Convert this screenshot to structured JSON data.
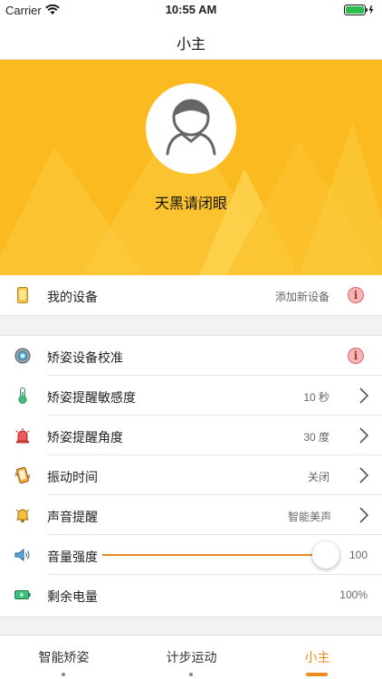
{
  "status_bar": {
    "carrier": "Carrier",
    "time": "10:55 AM"
  },
  "nav": {
    "title": "小主"
  },
  "header": {
    "username": "天黑请闭眼",
    "avatar_icon": "user-avatar-icon",
    "bg_color": "#fbbb20"
  },
  "device": {
    "label": "我的设备",
    "value": "添加新设备",
    "icon": "phone-icon"
  },
  "settings": {
    "calibrate": {
      "label": "矫姿设备校准",
      "icon": "target-icon"
    },
    "sensitivity": {
      "label": "矫姿提醒敏感度",
      "value": "10 秒",
      "icon": "thermometer-icon"
    },
    "angle": {
      "label": "矫姿提醒角度",
      "value": "30 度",
      "icon": "siren-icon"
    },
    "vibration": {
      "label": "振动时间",
      "value": "关闭",
      "icon": "vibrate-icon"
    },
    "sound": {
      "label": "声音提醒",
      "value": "智能美声",
      "icon": "bell-icon"
    },
    "volume": {
      "label": "音量强度",
      "value": "100",
      "level": 1.0,
      "icon": "speaker-icon"
    },
    "battery": {
      "label": "剩余电量",
      "value": "100%",
      "icon": "battery-icon"
    }
  },
  "info_badge": "i",
  "tabs": [
    {
      "label": "智能矫姿",
      "active": false
    },
    {
      "label": "计步运动",
      "active": false
    },
    {
      "label": "小主",
      "active": true
    }
  ],
  "colors": {
    "accent": "#ee8a1e",
    "header": "#fbbb20"
  }
}
